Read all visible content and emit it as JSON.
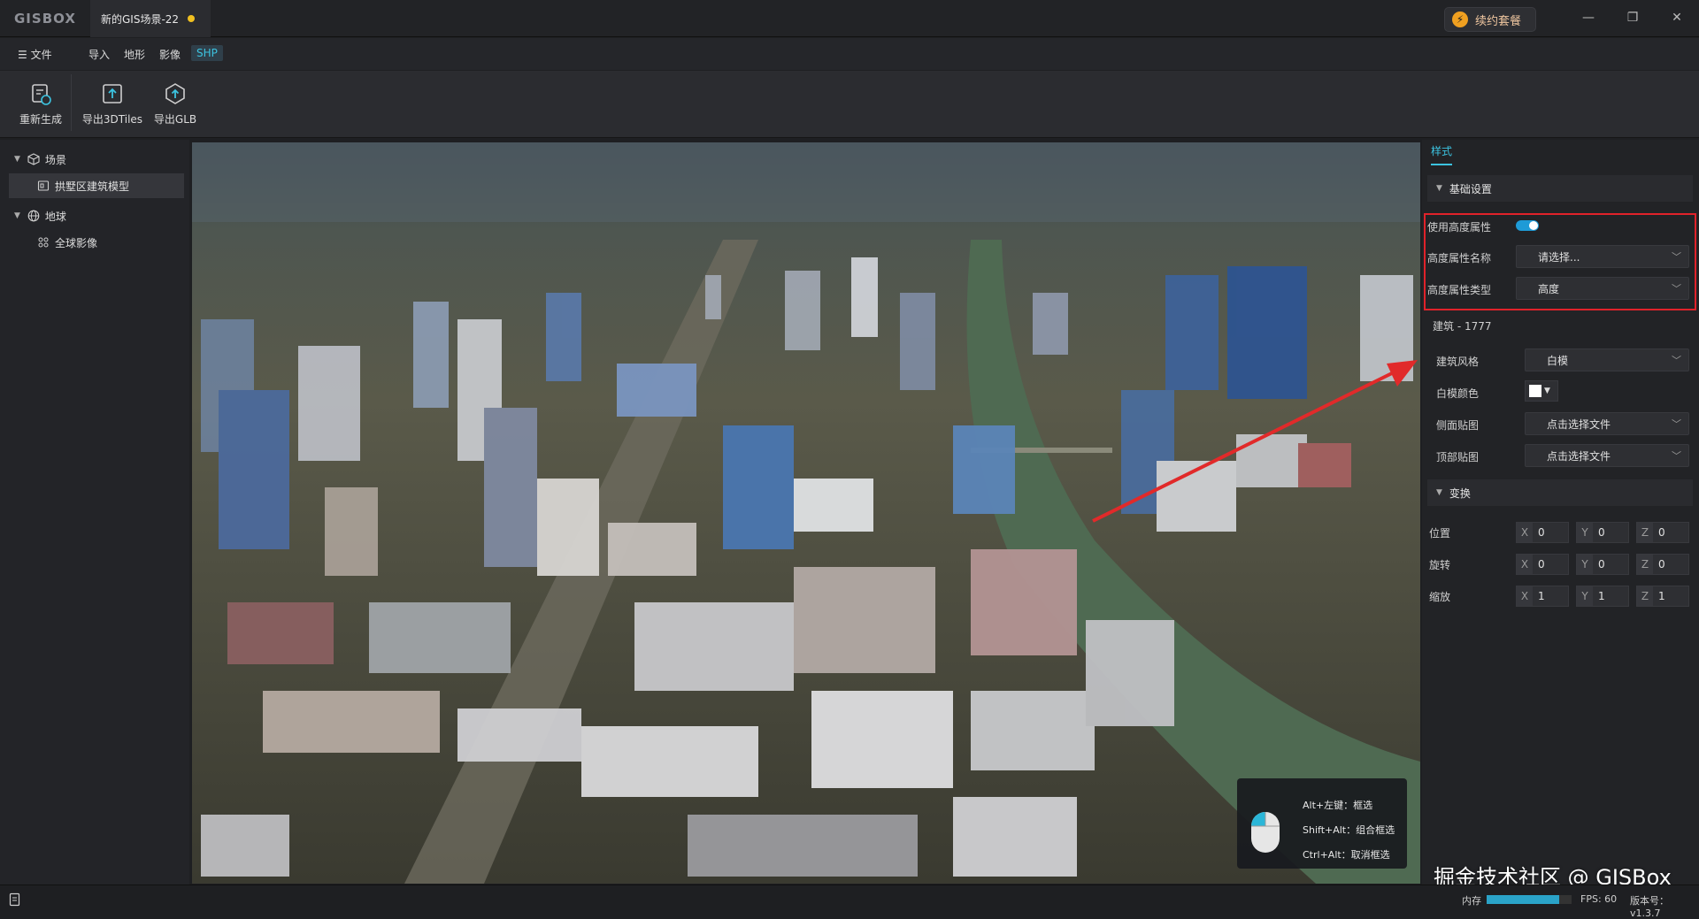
{
  "app": {
    "logo": "GISBOX",
    "tab_title": "新的GIS场景-22",
    "renew_label": "续约套餐",
    "window_controls": [
      "minimize-icon",
      "restore-icon",
      "close-icon"
    ]
  },
  "menu": {
    "file": "文件",
    "items": [
      "导入",
      "地形",
      "影像",
      "SHP"
    ],
    "active": "SHP"
  },
  "toolbar": {
    "regenerate": "重新生成",
    "export_3dtiles": "导出3DTiles",
    "export_glb": "导出GLB"
  },
  "tree": {
    "scene": "场景",
    "scene_child": "拱墅区建筑模型",
    "globe": "地球",
    "globe_child": "全球影像"
  },
  "right": {
    "tab": "样式",
    "basic_settings": "基础设置",
    "use_height_attr": "使用高度属性",
    "use_height_attr_on": true,
    "height_attr_name": "高度属性名称",
    "height_attr_name_value": "请选择...",
    "height_attr_type": "高度属性类型",
    "height_attr_type_value": "高度",
    "building_title": "建筑 - 1777",
    "building_style": "建筑风格",
    "building_style_value": "白模",
    "white_color": "白模颜色",
    "white_color_hex": "#ffffff",
    "side_texture": "侧面贴图",
    "side_texture_value": "点击选择文件",
    "top_texture": "顶部贴图",
    "top_texture_value": "点击选择文件",
    "transform": "变换",
    "position": "位置",
    "rotation": "旋转",
    "scale": "缩放",
    "axis_x": "X",
    "axis_y": "Y",
    "axis_z": "Z",
    "pos": [
      "0",
      "0",
      "0"
    ],
    "rot": [
      "0",
      "0",
      "0"
    ],
    "scl": [
      "1",
      "1",
      "1"
    ]
  },
  "hint": {
    "line1": "Alt+左键：框选",
    "line2": "Shift+Alt：组合框选",
    "line3": "Ctrl+Alt：取消框选"
  },
  "status": {
    "mem_label": "内存",
    "mem_fraction": 0.85,
    "fps": "FPS: 60",
    "version": "版本号：v1.3.7"
  },
  "watermark": "掘金技术社区 @ GISBox",
  "colors": {
    "accent": "#3cc3e0",
    "highlight_box": "#e0222a",
    "toggle_on": "#1e9bd7",
    "unsaved_dot": "#f0c020"
  }
}
